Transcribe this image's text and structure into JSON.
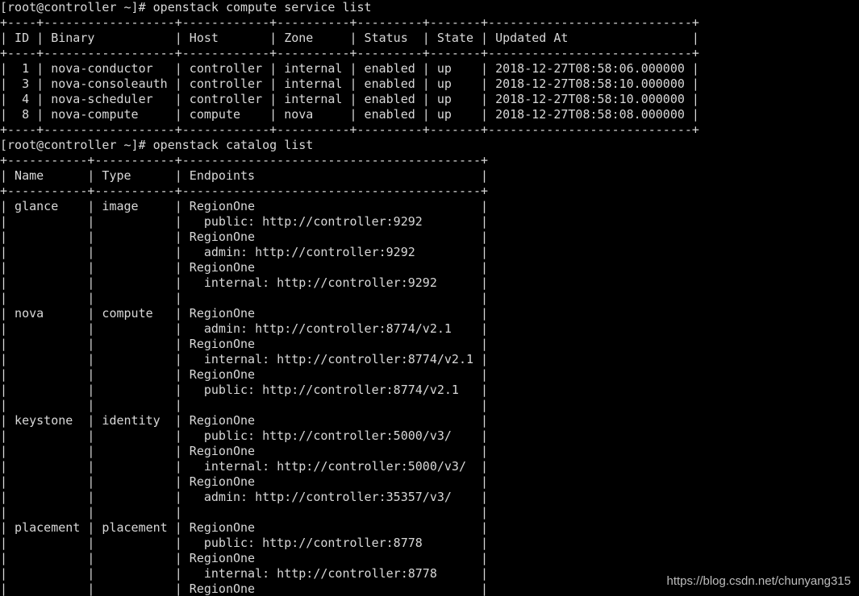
{
  "terminal": {
    "lines": [
      "[root@controller ~]# openstack compute service list",
      "+----+------------------+------------+----------+---------+-------+----------------------------+",
      "| ID | Binary           | Host       | Zone     | Status  | State | Updated At                 |",
      "+----+------------------+------------+----------+---------+-------+----------------------------+",
      "|  1 | nova-conductor   | controller | internal | enabled | up    | 2018-12-27T08:58:06.000000 |",
      "|  3 | nova-consoleauth | controller | internal | enabled | up    | 2018-12-27T08:58:10.000000 |",
      "|  4 | nova-scheduler   | controller | internal | enabled | up    | 2018-12-27T08:58:10.000000 |",
      "|  8 | nova-compute     | compute    | nova     | enabled | up    | 2018-12-27T08:58:08.000000 |",
      "+----+------------------+------------+----------+---------+-------+----------------------------+",
      "[root@controller ~]# openstack catalog list",
      "+-----------+-----------+-----------------------------------------+",
      "| Name      | Type      | Endpoints                               |",
      "+-----------+-----------+-----------------------------------------+",
      "| glance    | image     | RegionOne                               |",
      "|           |           |   public: http://controller:9292        |",
      "|           |           | RegionOne                               |",
      "|           |           |   admin: http://controller:9292         |",
      "|           |           | RegionOne                               |",
      "|           |           |   internal: http://controller:9292      |",
      "|           |           |                                         |",
      "| nova      | compute   | RegionOne                               |",
      "|           |           |   admin: http://controller:8774/v2.1    |",
      "|           |           | RegionOne                               |",
      "|           |           |   internal: http://controller:8774/v2.1 |",
      "|           |           | RegionOne                               |",
      "|           |           |   public: http://controller:8774/v2.1   |",
      "|           |           |                                         |",
      "| keystone  | identity  | RegionOne                               |",
      "|           |           |   public: http://controller:5000/v3/    |",
      "|           |           | RegionOne                               |",
      "|           |           |   internal: http://controller:5000/v3/  |",
      "|           |           | RegionOne                               |",
      "|           |           |   admin: http://controller:35357/v3/    |",
      "|           |           |                                         |",
      "| placement | placement | RegionOne                               |",
      "|           |           |   public: http://controller:8778        |",
      "|           |           | RegionOne                               |",
      "|           |           |   internal: http://controller:8778      |",
      "|           |           | RegionOne                               |"
    ]
  },
  "watermark": {
    "text": "https://blog.csdn.net/chunyang315"
  },
  "colors": {
    "background": "#000000",
    "foreground": "#d8d8d8"
  }
}
